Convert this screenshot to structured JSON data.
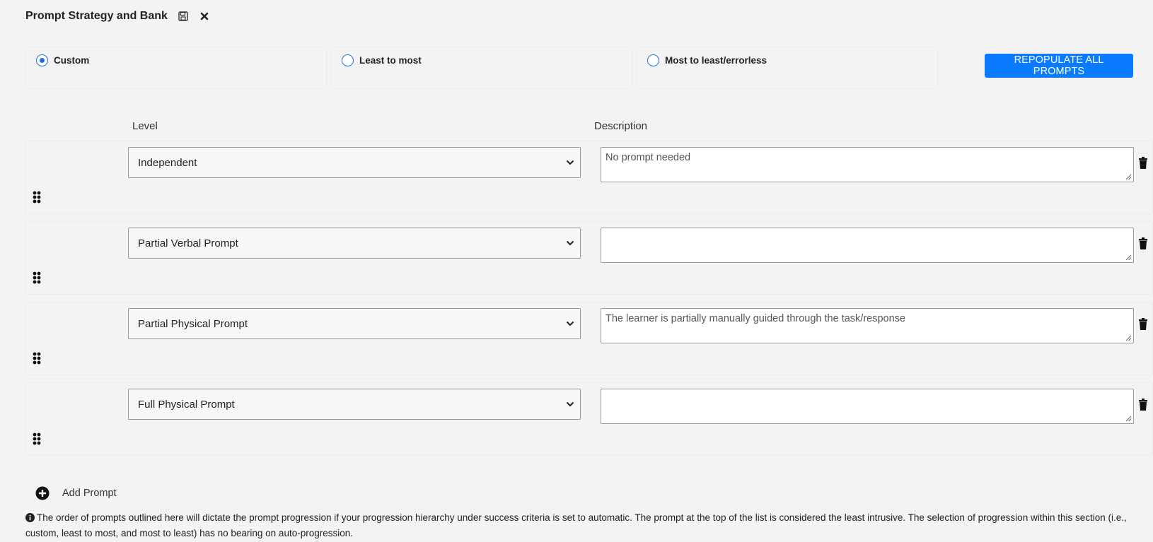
{
  "header": {
    "title": "Prompt Strategy and Bank",
    "icons": [
      "save-icon",
      "close-icon"
    ]
  },
  "strategy": {
    "options": [
      {
        "label": "Custom",
        "selected": true
      },
      {
        "label": "Least to most",
        "selected": false
      },
      {
        "label": "Most to least/errorless",
        "selected": false
      }
    ],
    "repopulate_label": "REPOPULATE ALL PROMPTS"
  },
  "columns": {
    "level": "Level",
    "description": "Description"
  },
  "prompts": [
    {
      "level": "Independent",
      "description": "No prompt needed"
    },
    {
      "level": "Partial Verbal Prompt",
      "description": ""
    },
    {
      "level": "Partial Physical Prompt",
      "description": "The learner is partially manually guided through the task/response"
    },
    {
      "level": "Full Physical Prompt",
      "description": ""
    }
  ],
  "add_prompt_label": "Add Prompt",
  "info_note": "The order of prompts outlined here will dictate the prompt progression if your progression hierarchy under success criteria is set to automatic. The prompt at the top of the list is considered the least intrusive. The selection of progression within this section (i.e., custom, least to most, and most to least) has no bearing on auto-progression.",
  "colors": {
    "accent": "#0a7bff",
    "radio": "#1a73d8",
    "background": "#f3f3f3"
  }
}
